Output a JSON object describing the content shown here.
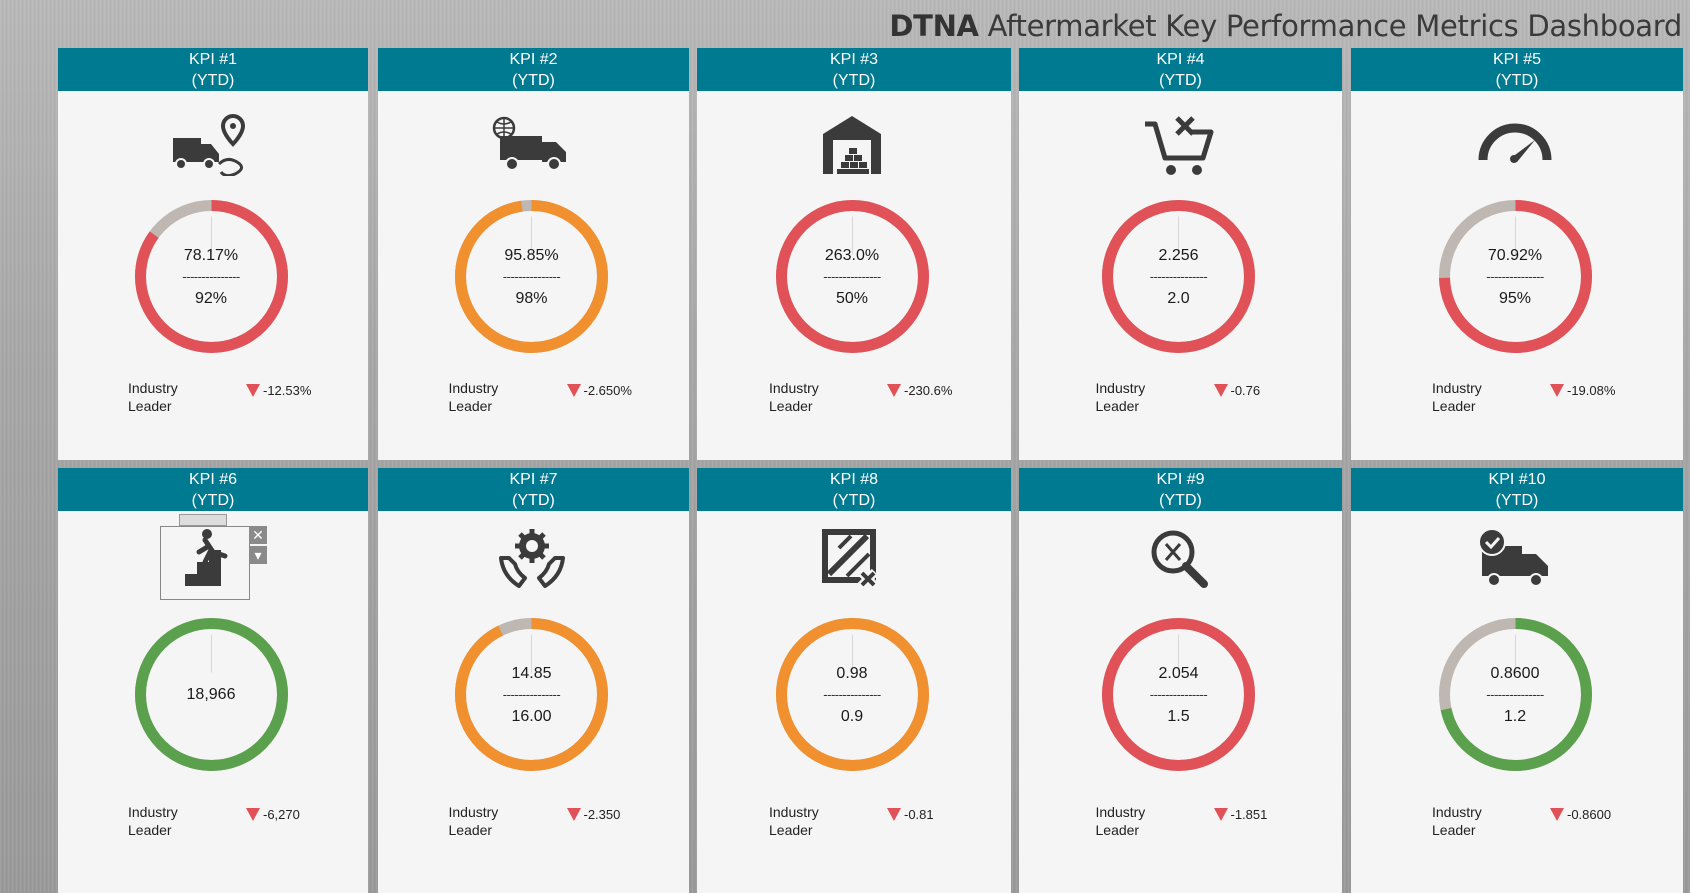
{
  "dashboard": {
    "title_bold": "DTNA",
    "title_rest": " Aftermarket Key Performance Metrics Dashboard"
  },
  "colors": {
    "header": "#007a91",
    "red": "#e05258",
    "orange": "#f0902f",
    "green": "#5ba04d",
    "gray": "#bfb7b2"
  },
  "kpis": [
    {
      "label": "KPI #1",
      "period": "(YTD)",
      "icon": "truck-route-icon",
      "actual": "78.17%",
      "separator": "---------------",
      "target": "92%",
      "fill": 0.85,
      "color": "red",
      "leader": "Industry Leader",
      "delta": "-12.53%"
    },
    {
      "label": "KPI #2",
      "period": "(YTD)",
      "icon": "global-delivery-truck-icon",
      "actual": "95.85%",
      "separator": "---------------",
      "target": "98%",
      "fill": 0.978,
      "color": "orange",
      "leader": "Industry Leader",
      "delta": "-2.650%"
    },
    {
      "label": "KPI #3",
      "period": "(YTD)",
      "icon": "warehouse-icon",
      "actual": "263.0%",
      "separator": "---------------",
      "target": "50%",
      "fill": 1.0,
      "color": "red",
      "leader": "Industry Leader",
      "delta": "-230.6%"
    },
    {
      "label": "KPI #4",
      "period": "(YTD)",
      "icon": "cart-cancel-icon",
      "actual": "2.256",
      "separator": "---------------",
      "target": "2.0",
      "fill": 1.0,
      "color": "red",
      "leader": "Industry Leader",
      "delta": "-0.76"
    },
    {
      "label": "KPI #5",
      "period": "(YTD)",
      "icon": "speedometer-icon",
      "actual": "70.92%",
      "separator": "---------------",
      "target": "95%",
      "fill": 0.7465,
      "color": "red",
      "leader": "Industry Leader",
      "delta": "-19.08%"
    },
    {
      "label": "KPI #6",
      "period": "(YTD)",
      "icon": "fall-hazard-icon",
      "actual": "18,966",
      "separator": "",
      "target": "",
      "fill": 1.0,
      "color": "green",
      "leader": "Industry Leader",
      "delta": "-6,270"
    },
    {
      "label": "KPI #7",
      "period": "(YTD)",
      "icon": "hands-gear-icon",
      "actual": "14.85",
      "separator": "---------------",
      "target": "16.00",
      "fill": 0.928,
      "color": "orange",
      "leader": "Industry Leader",
      "delta": "-2.350"
    },
    {
      "label": "KPI #8",
      "period": "(YTD)",
      "icon": "damaged-crate-icon",
      "actual": "0.98",
      "separator": "---------------",
      "target": "0.9",
      "fill": 1.0,
      "color": "orange",
      "leader": "Industry Leader",
      "delta": "-0.81"
    },
    {
      "label": "KPI #9",
      "period": "(YTD)",
      "icon": "search-error-icon",
      "actual": "2.054",
      "separator": "---------------",
      "target": "1.5",
      "fill": 1.0,
      "color": "red",
      "leader": "Industry Leader",
      "delta": "-1.851"
    },
    {
      "label": "KPI #10",
      "period": "(YTD)",
      "icon": "truck-check-icon",
      "actual": "0.8600",
      "separator": "---------------",
      "target": "1.2",
      "fill": 0.7167,
      "color": "green",
      "leader": "Industry Leader",
      "delta": "-0.8600"
    }
  ]
}
